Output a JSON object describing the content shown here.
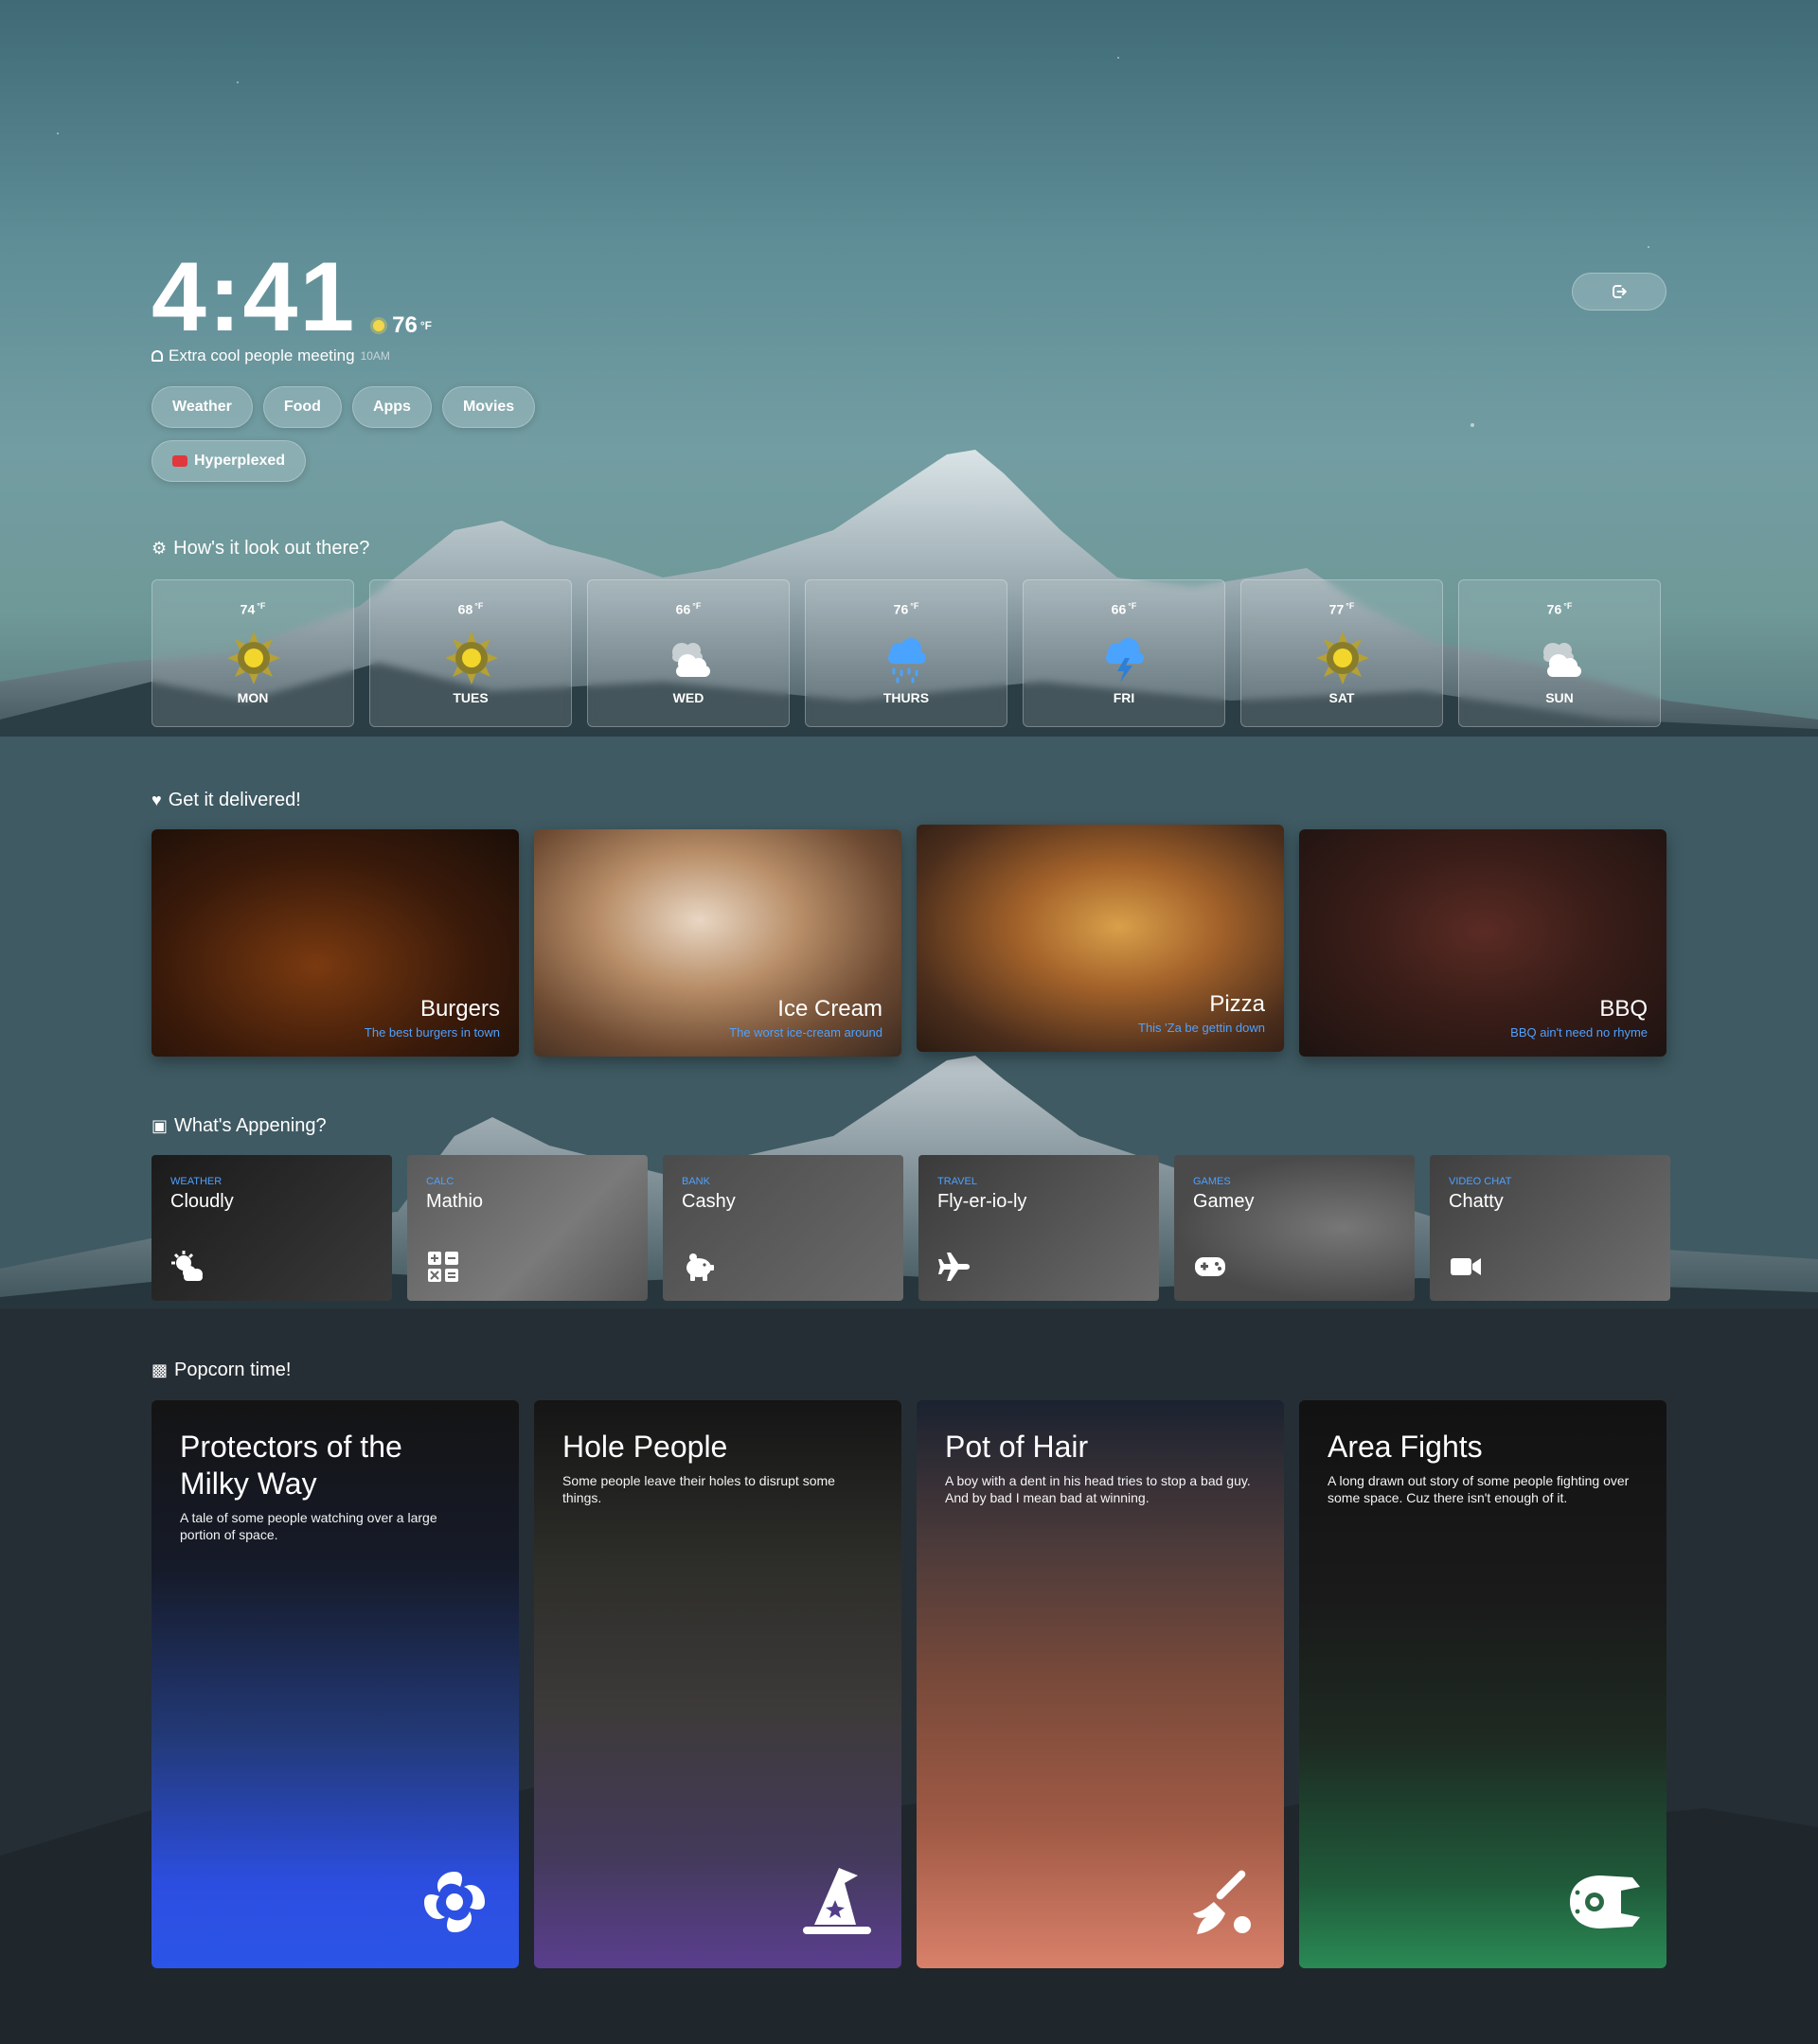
{
  "clock": {
    "time": "4:41",
    "temp": "76",
    "unit": "°F"
  },
  "event": {
    "title": "Extra cool people meeting",
    "time": "10AM"
  },
  "nav": {
    "pills": [
      "Weather",
      "Food",
      "Apps",
      "Movies"
    ],
    "youtube": "Hyperplexed"
  },
  "weather": {
    "title": "How's it look out there?",
    "days": [
      {
        "temp": "74",
        "unit": "°F",
        "day": "MON",
        "icon": "sun-icon"
      },
      {
        "temp": "68",
        "unit": "°F",
        "day": "TUES",
        "icon": "sun-icon"
      },
      {
        "temp": "66",
        "unit": "°F",
        "day": "WED",
        "icon": "cloud-icon"
      },
      {
        "temp": "76",
        "unit": "°F",
        "day": "THURS",
        "icon": "rain-icon"
      },
      {
        "temp": "66",
        "unit": "°F",
        "day": "FRI",
        "icon": "storm-icon"
      },
      {
        "temp": "77",
        "unit": "°F",
        "day": "SAT",
        "icon": "sun-icon"
      },
      {
        "temp": "76",
        "unit": "°F",
        "day": "SUN",
        "icon": "cloud-icon"
      }
    ]
  },
  "food": {
    "title": "Get it delivered!",
    "items": [
      {
        "title": "Burgers",
        "subtitle": "The best burgers in town"
      },
      {
        "title": "Ice Cream",
        "subtitle": "The worst ice-cream around"
      },
      {
        "title": "Pizza",
        "subtitle": "This 'Za be gettin down"
      },
      {
        "title": "BBQ",
        "subtitle": "BBQ ain't need no rhyme"
      }
    ]
  },
  "apps": {
    "title": "What's Appening?",
    "items": [
      {
        "category": "WEATHER",
        "name": "Cloudly",
        "icon": "cloud-sun-icon"
      },
      {
        "category": "CALC",
        "name": "Mathio",
        "icon": "calculator-icon"
      },
      {
        "category": "BANK",
        "name": "Cashy",
        "icon": "piggy-bank-icon"
      },
      {
        "category": "TRAVEL",
        "name": "Fly-er-io-ly",
        "icon": "plane-icon"
      },
      {
        "category": "GAMES",
        "name": "Gamey",
        "icon": "gamepad-icon"
      },
      {
        "category": "VIDEO CHAT",
        "name": "Chatty",
        "icon": "video-camera-icon"
      }
    ]
  },
  "movies": {
    "title": "Popcorn time!",
    "items": [
      {
        "title": "Protectors of the Milky Way",
        "description": "A tale of some people watching over a large portion of space.",
        "icon": "galaxy-icon"
      },
      {
        "title": "Hole People",
        "description": "Some people leave their holes to disrupt some things.",
        "icon": "wizard-hat-icon"
      },
      {
        "title": "Pot of Hair",
        "description": "A boy with a dent in his head tries to stop a bad guy. And by bad I mean bad at winning.",
        "icon": "broom-icon"
      },
      {
        "title": "Area Fights",
        "description": "A long drawn out story of some people fighting over some space. Cuz there isn't enough of it.",
        "icon": "spaceship-icon"
      }
    ]
  },
  "colors": {
    "accent": "#4ea1ff",
    "youtube": "#e0383c",
    "sun": "#e8c93a"
  }
}
